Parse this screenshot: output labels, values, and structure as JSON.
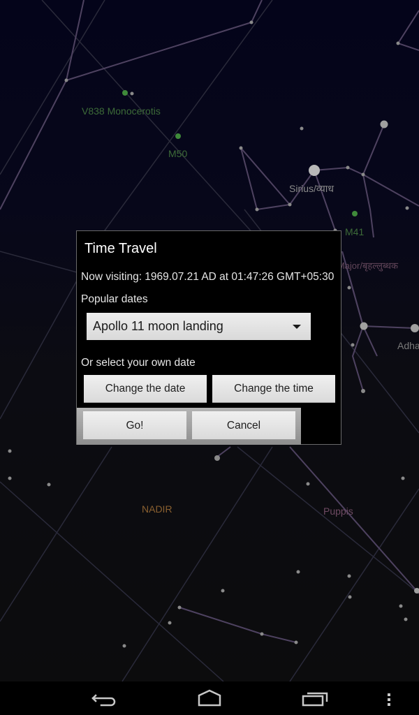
{
  "sky_map": {
    "labels": {
      "v838": "V838 Monocerotis",
      "m50": "M50",
      "sirius": "Sirius/व्याध",
      "m41": "M41",
      "canis_major": "Canis Major/बृहल्लुब्धक",
      "adhara": "Adha",
      "nadir": "NADIR",
      "puppis": "Puppis"
    },
    "colors": {
      "messier": "#3f7a3a",
      "star_label": "#8a8a8a",
      "constellation_label": "#6e4a62",
      "nadir": "#8a6030",
      "constellation_line": "#4a3f5a",
      "grid_line": "#2a2a35"
    }
  },
  "dialog": {
    "title": "Time Travel",
    "now_visiting": "Now visiting: 1969.07.21 AD at 01:47:26 GMT+05:30",
    "popular_dates_label": "Popular dates",
    "popular_dates_selected": "Apollo 11 moon landing",
    "own_date_label": "Or select your own date",
    "change_date_label": "Change the date",
    "change_time_label": "Change the time",
    "go_label": "Go!",
    "cancel_label": "Cancel"
  },
  "navbar": {
    "icons": [
      "back-icon",
      "home-icon",
      "recent-apps-icon",
      "overflow-menu-icon"
    ]
  }
}
